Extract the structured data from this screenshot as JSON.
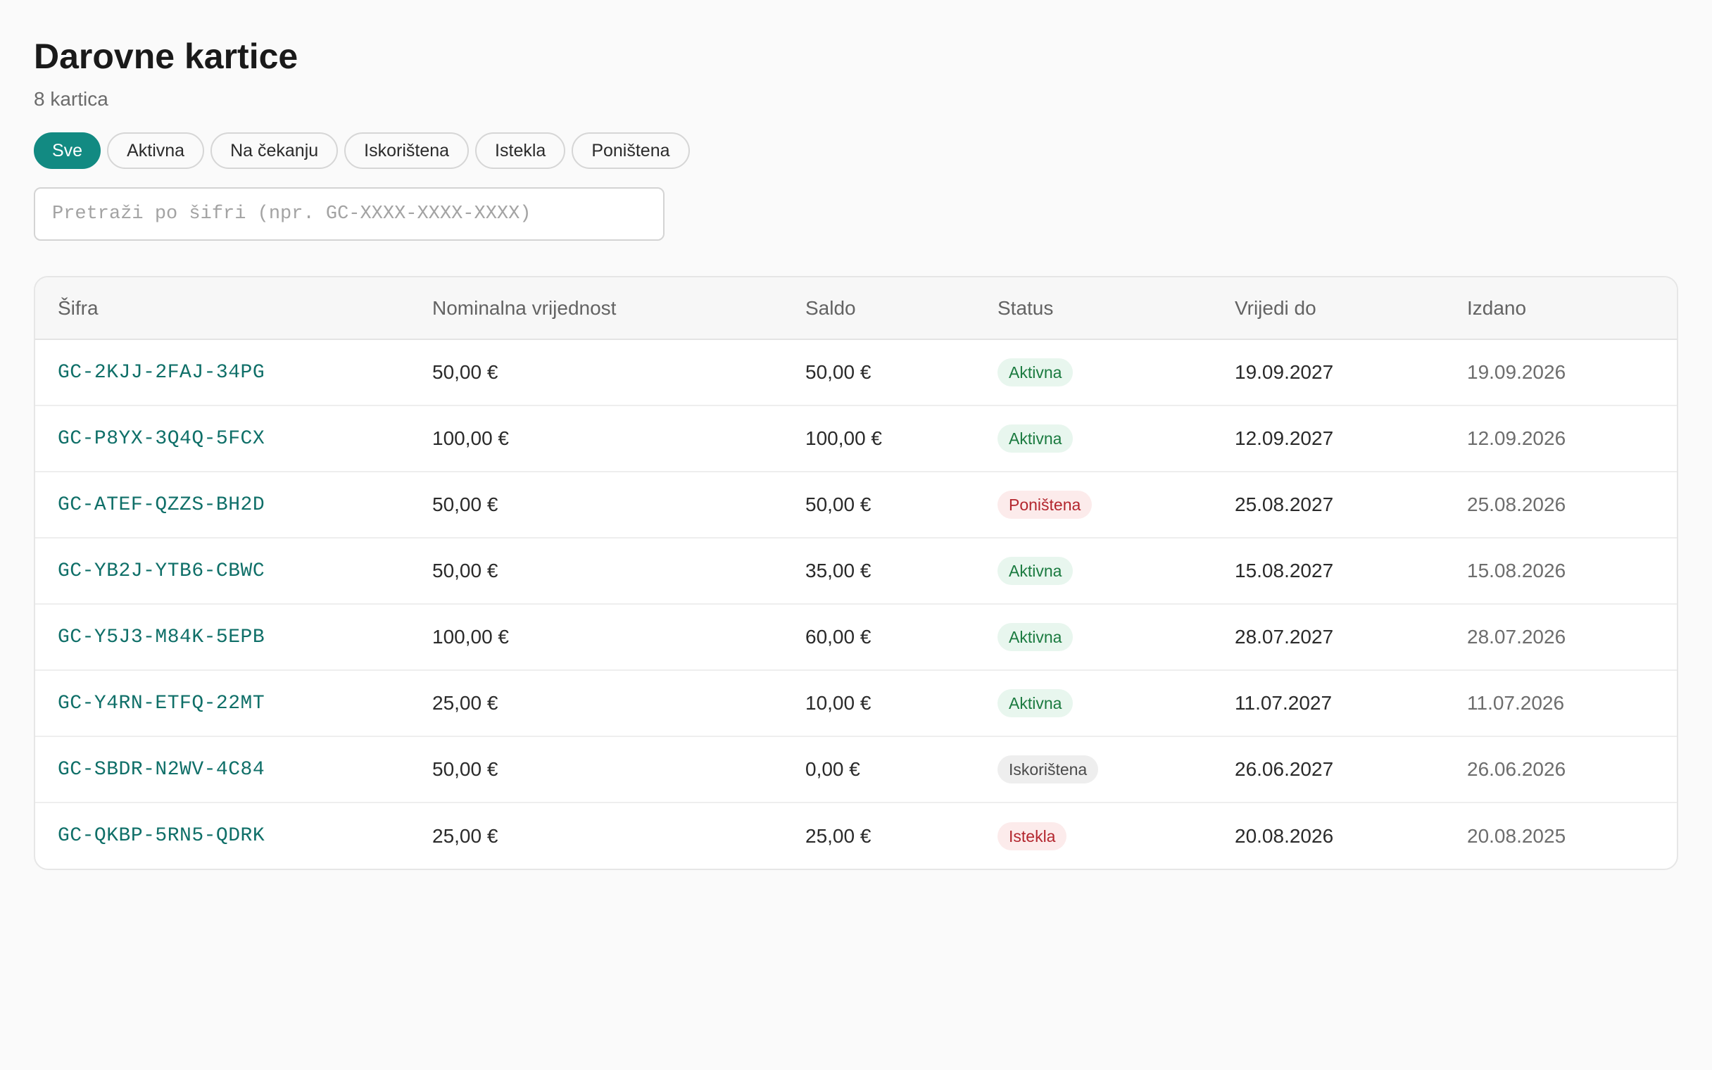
{
  "page": {
    "title": "Darovne kartice",
    "count": "8 kartica"
  },
  "filters": [
    {
      "label": "Sve",
      "active": true
    },
    {
      "label": "Aktivna",
      "active": false
    },
    {
      "label": "Na čekanju",
      "active": false
    },
    {
      "label": "Iskorištena",
      "active": false
    },
    {
      "label": "Istekla",
      "active": false
    },
    {
      "label": "Poništena",
      "active": false
    }
  ],
  "search": {
    "placeholder": "Pretraži po šifri (npr. GC-XXXX-XXXX-XXXX)",
    "value": ""
  },
  "table": {
    "headers": {
      "code": "Šifra",
      "nominal": "Nominalna vrijednost",
      "balance": "Saldo",
      "status": "Status",
      "valid_until": "Vrijedi do",
      "issued": "Izdano"
    },
    "rows": [
      {
        "code": "GC-2KJJ-2FAJ-34PG",
        "nominal": "50,00 €",
        "balance": "50,00 €",
        "status": "Aktivna",
        "status_tone": "green",
        "valid_until": "19.09.2027",
        "issued": "19.09.2026"
      },
      {
        "code": "GC-P8YX-3Q4Q-5FCX",
        "nominal": "100,00 €",
        "balance": "100,00 €",
        "status": "Aktivna",
        "status_tone": "green",
        "valid_until": "12.09.2027",
        "issued": "12.09.2026"
      },
      {
        "code": "GC-ATEF-QZZS-BH2D",
        "nominal": "50,00 €",
        "balance": "50,00 €",
        "status": "Poništena",
        "status_tone": "red",
        "valid_until": "25.08.2027",
        "issued": "25.08.2026"
      },
      {
        "code": "GC-YB2J-YTB6-CBWC",
        "nominal": "50,00 €",
        "balance": "35,00 €",
        "status": "Aktivna",
        "status_tone": "green",
        "valid_until": "15.08.2027",
        "issued": "15.08.2026"
      },
      {
        "code": "GC-Y5J3-M84K-5EPB",
        "nominal": "100,00 €",
        "balance": "60,00 €",
        "status": "Aktivna",
        "status_tone": "green",
        "valid_until": "28.07.2027",
        "issued": "28.07.2026"
      },
      {
        "code": "GC-Y4RN-ETFQ-22MT",
        "nominal": "25,00 €",
        "balance": "10,00 €",
        "status": "Aktivna",
        "status_tone": "green",
        "valid_until": "11.07.2027",
        "issued": "11.07.2026"
      },
      {
        "code": "GC-SBDR-N2WV-4C84",
        "nominal": "50,00 €",
        "balance": "0,00 €",
        "status": "Iskorištena",
        "status_tone": "gray",
        "valid_until": "26.06.2027",
        "issued": "26.06.2026"
      },
      {
        "code": "GC-QKBP-5RN5-QDRK",
        "nominal": "25,00 €",
        "balance": "25,00 €",
        "status": "Istekla",
        "status_tone": "red",
        "valid_until": "20.08.2026",
        "issued": "20.08.2025"
      }
    ]
  },
  "colors": {
    "accent": "#128a82",
    "code_text": "#0f6f68",
    "status_green_bg": "#e8f6ee",
    "status_green_text": "#1a7a3f",
    "status_red_bg": "#fcebeb",
    "status_red_text": "#b3262e",
    "status_gray_bg": "#eeeeee"
  }
}
